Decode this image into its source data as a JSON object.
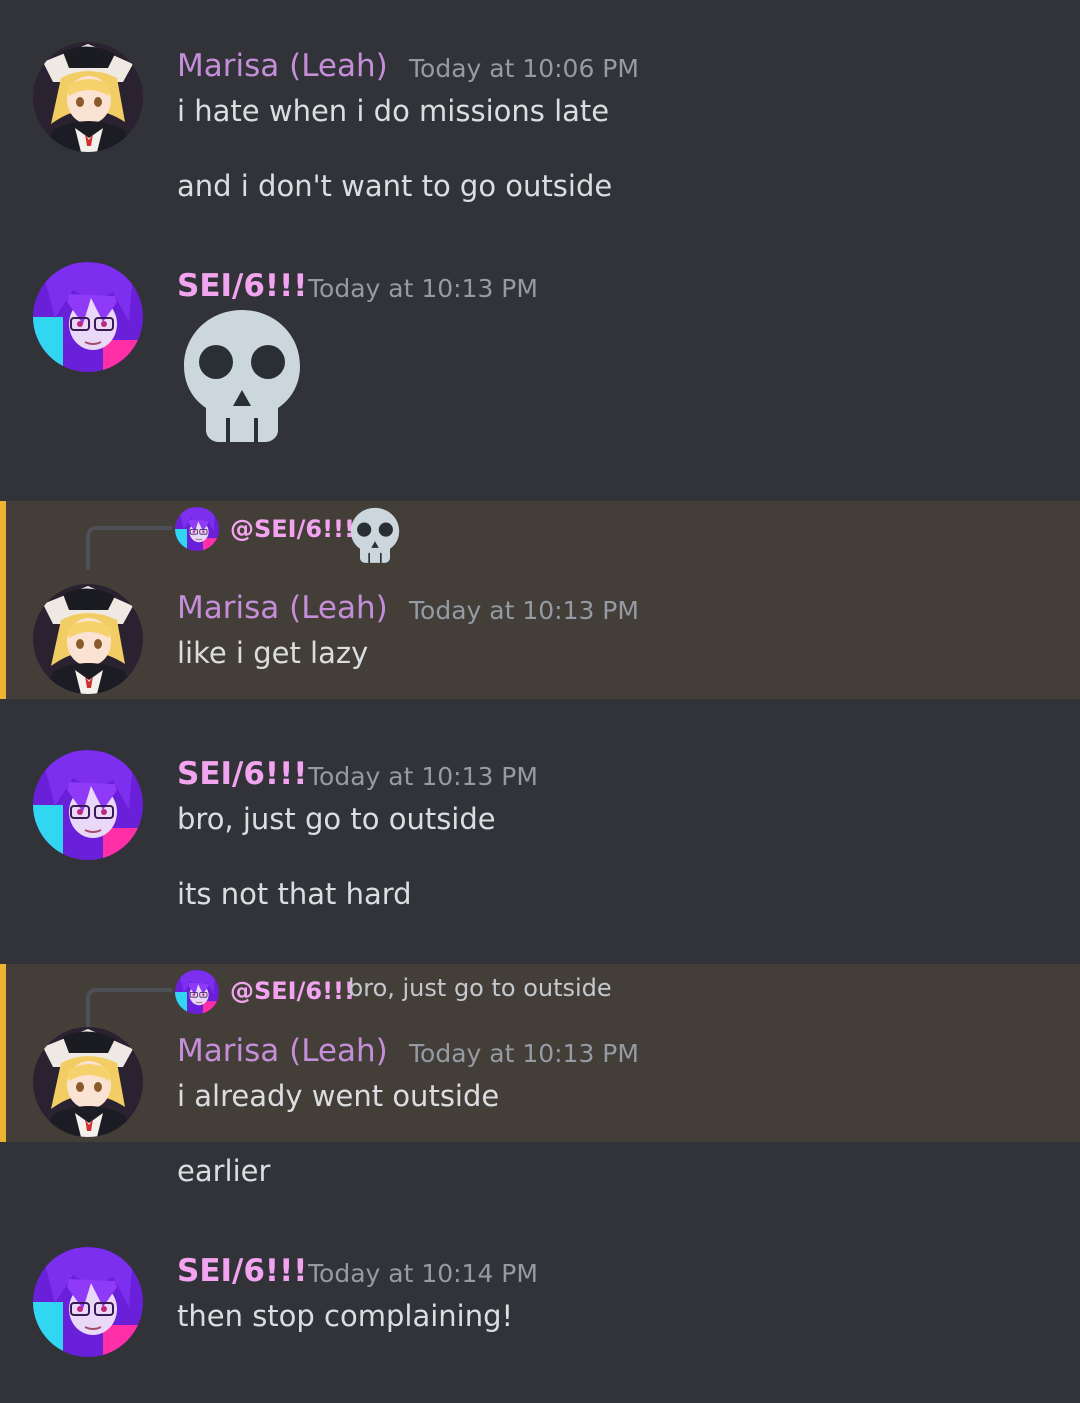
{
  "users": {
    "marisa": {
      "name": "Marisa (Leah)",
      "color": "#c48ed9"
    },
    "sei": {
      "name": "SEI/6!!!",
      "mention": "@SEI/6!!!",
      "color": "#f3a4f1"
    }
  },
  "theme": {
    "background": "#313338",
    "highlight_background": "#443e38",
    "highlight_bar": "#f0b232",
    "timestamp_color": "#949ba4"
  },
  "messages": [
    {
      "author": "Marisa (Leah)",
      "timestamp": "Today at 10:06 PM",
      "lines": [
        "i hate when i do missions late",
        "and i don't want to go outside"
      ]
    },
    {
      "author": "SEI/6!!!",
      "timestamp": "Today at 10:13 PM",
      "emoji": "skull-emoji"
    },
    {
      "author": "Marisa (Leah)",
      "timestamp": "Today at 10:13 PM",
      "highlighted": true,
      "reply": {
        "mention": "@SEI/6!!!",
        "preview_emoji": "skull-emoji"
      },
      "lines": [
        "like i get lazy"
      ]
    },
    {
      "author": "SEI/6!!!",
      "timestamp": "Today at 10:13 PM",
      "lines": [
        "bro, just go to outside",
        "its not that hard"
      ]
    },
    {
      "author": "Marisa (Leah)",
      "timestamp": "Today at 10:13 PM",
      "highlighted": true,
      "reply": {
        "mention": "@SEI/6!!!",
        "preview_text": "bro, just go to outside"
      },
      "lines": [
        "i already went outside",
        "earlier"
      ]
    },
    {
      "author": "SEI/6!!!",
      "timestamp": "Today at 10:14 PM",
      "lines": [
        "then stop complaining!"
      ]
    }
  ]
}
